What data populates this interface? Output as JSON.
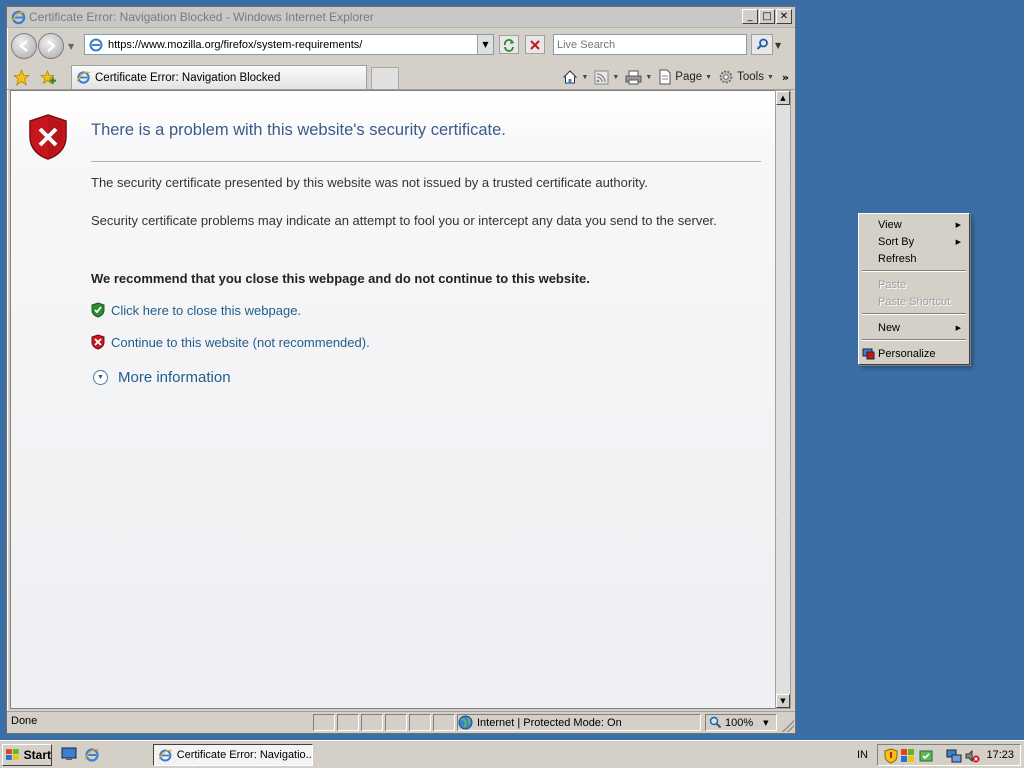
{
  "window": {
    "title": "Certificate Error: Navigation Blocked - Windows Internet Explorer",
    "minimize_glyph": "_",
    "maximize_glyph": "□",
    "close_glyph": "✕"
  },
  "navbar": {
    "address": "https://www.mozilla.org/firefox/system-requirements/",
    "search_placeholder": "Live Search"
  },
  "tabbar": {
    "tab_label": "Certificate Error: Navigation Blocked",
    "commands": {
      "page": "Page",
      "tools": "Tools",
      "more": "»"
    }
  },
  "content": {
    "title": "There is a problem with this website's security certificate.",
    "paragraph1": "The security certificate presented by this website was not issued by a trusted certificate authority.",
    "paragraph2": "Security certificate problems may indicate an attempt to fool you or intercept any data you send to the server.",
    "recommendation": "We recommend that you close this webpage and do not continue to this website.",
    "close_link": "Click here to close this webpage.",
    "continue_link": "Continue to this website (not recommended).",
    "more_info": "More information"
  },
  "statusbar": {
    "status": "Done",
    "zone": "Internet | Protected Mode: On",
    "zoom": "100%"
  },
  "context_menu": {
    "items": [
      {
        "label": "View"
      },
      {
        "label": "Sort By"
      },
      {
        "label": "Refresh"
      },
      {
        "label": "Paste"
      },
      {
        "label": "Paste Shortcut"
      },
      {
        "label": "New"
      },
      {
        "label": "Personalize"
      }
    ]
  },
  "taskbar": {
    "start": "Start",
    "task_label": "Certificate Error: Navigatio...",
    "language": "IN",
    "clock": "17:23"
  },
  "colors": {
    "desktop": "#3a6ea5",
    "heading": "#3a5a8c",
    "link": "#1f5e8c",
    "error_red": "#c8161d",
    "safe_green": "#2e8b2e"
  },
  "icons": [
    "ie-icon",
    "back-icon",
    "forward-icon",
    "page-icon",
    "refresh-icon",
    "stop-icon",
    "search-icon",
    "favorites-star-icon",
    "add-favorites-icon",
    "home-icon",
    "feeds-icon",
    "print-icon",
    "page-menu-icon",
    "tools-gear-icon",
    "shield-error-icon",
    "shield-ok-icon",
    "expand-circle-icon",
    "globe-icon",
    "zoom-icon",
    "windows-flag-icon",
    "show-desktop-icon",
    "volume-muted-icon",
    "network-icon"
  ]
}
